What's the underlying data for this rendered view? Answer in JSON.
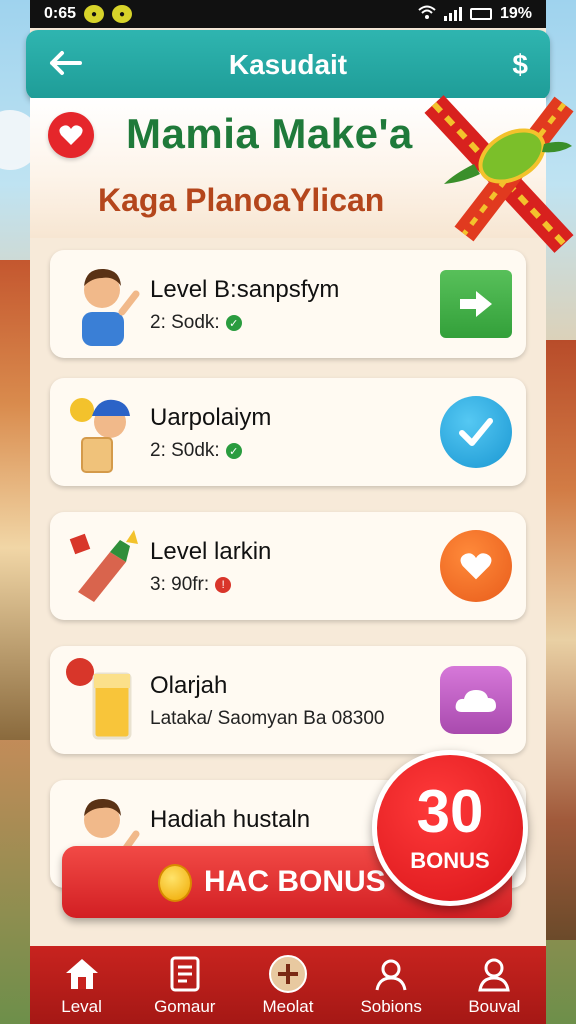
{
  "status_bar": {
    "time": "0:65",
    "battery": "19%"
  },
  "header": {
    "back_icon": "arrow-left-icon",
    "title": "Kasudait",
    "right_label": "$"
  },
  "banner": {
    "title": "Mamia Make'a",
    "subtitle": "Kaga PlanoaYlican"
  },
  "items": [
    {
      "title": "Level B:sanpsfym",
      "meta": "2: Sodk:",
      "action_icon": "arrow-right-icon"
    },
    {
      "title": "Uarpolaiym",
      "meta": "2: S0dk:",
      "action_icon": "check-icon"
    },
    {
      "title": "Level larkin",
      "meta": "3: 90fr:",
      "action_icon": "heart-icon"
    },
    {
      "title": "Olarjah",
      "meta": "Lataka/ Saomyan Ba 08300",
      "action_icon": "cloud-icon"
    },
    {
      "title": "Hadiah hustaln",
      "meta": "",
      "action_icon": ""
    }
  ],
  "bonus_button": {
    "label": "HAC BONUS"
  },
  "bonus_badge": {
    "number": "30",
    "text": "BONUS"
  },
  "nav": [
    {
      "label": "Leval",
      "icon": "home-icon"
    },
    {
      "label": "Gomaur",
      "icon": "document-icon"
    },
    {
      "label": "Meolat",
      "icon": "plus-circle-icon"
    },
    {
      "label": "Sobions",
      "icon": "user-badge-icon"
    },
    {
      "label": "Bouval",
      "icon": "profile-icon"
    }
  ],
  "colors": {
    "header": "#1e9c97",
    "accent_red": "#d21f23",
    "banner_title": "#1f7a3a"
  }
}
